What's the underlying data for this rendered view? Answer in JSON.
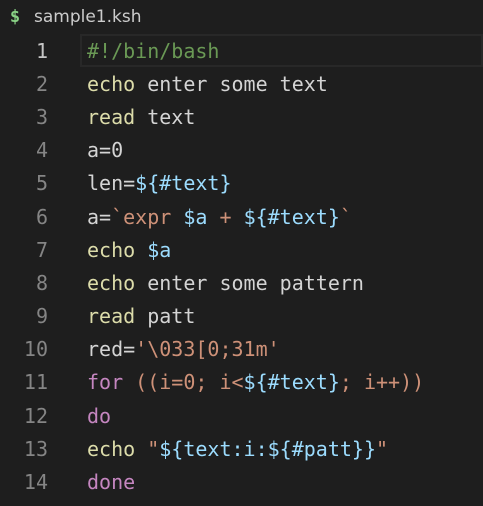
{
  "tab": {
    "icon": "$",
    "title": "sample1.ksh"
  },
  "editor": {
    "current_line": 1,
    "lines": [
      {
        "number": "1",
        "tokens": [
          {
            "text": "#!/bin/bash",
            "kind": "cmt"
          }
        ]
      },
      {
        "number": "2",
        "tokens": [
          {
            "text": "echo",
            "kind": "cmd"
          },
          {
            "text": " enter some text",
            "kind": "text"
          }
        ]
      },
      {
        "number": "3",
        "tokens": [
          {
            "text": "read",
            "kind": "cmd"
          },
          {
            "text": " text",
            "kind": "text"
          }
        ]
      },
      {
        "number": "4",
        "tokens": [
          {
            "text": "a=0",
            "kind": "text"
          }
        ]
      },
      {
        "number": "5",
        "tokens": [
          {
            "text": "len=",
            "kind": "text"
          },
          {
            "text": "${#text}",
            "kind": "var"
          }
        ]
      },
      {
        "number": "6",
        "tokens": [
          {
            "text": "a=",
            "kind": "text"
          },
          {
            "text": "`expr ",
            "kind": "str"
          },
          {
            "text": "$a",
            "kind": "var"
          },
          {
            "text": " + ",
            "kind": "str"
          },
          {
            "text": "${#text}",
            "kind": "var"
          },
          {
            "text": "`",
            "kind": "str"
          }
        ]
      },
      {
        "number": "7",
        "tokens": [
          {
            "text": "echo",
            "kind": "cmd"
          },
          {
            "text": " ",
            "kind": "text"
          },
          {
            "text": "$a",
            "kind": "var"
          }
        ]
      },
      {
        "number": "8",
        "tokens": [
          {
            "text": "echo",
            "kind": "cmd"
          },
          {
            "text": " enter some pattern",
            "kind": "text"
          }
        ]
      },
      {
        "number": "9",
        "tokens": [
          {
            "text": "read",
            "kind": "cmd"
          },
          {
            "text": " patt",
            "kind": "text"
          }
        ]
      },
      {
        "number": "10",
        "tokens": [
          {
            "text": "red=",
            "kind": "text"
          },
          {
            "text": "'\\033[0;31m'",
            "kind": "str"
          }
        ]
      },
      {
        "number": "11",
        "tokens": [
          {
            "text": "for",
            "kind": "kw"
          },
          {
            "text": " ((i=0; i<",
            "kind": "str"
          },
          {
            "text": "${#text}",
            "kind": "var"
          },
          {
            "text": "; i++))",
            "kind": "str"
          }
        ]
      },
      {
        "number": "12",
        "tokens": [
          {
            "text": "do",
            "kind": "kw"
          }
        ]
      },
      {
        "number": "13",
        "tokens": [
          {
            "text": "echo",
            "kind": "cmd"
          },
          {
            "text": " \"",
            "kind": "str"
          },
          {
            "text": "${text:i:${#patt}}",
            "kind": "var"
          },
          {
            "text": "\"",
            "kind": "str"
          }
        ]
      },
      {
        "number": "14",
        "tokens": [
          {
            "text": "done",
            "kind": "kw"
          }
        ]
      }
    ]
  },
  "colors": {
    "background": "#1e1e1e",
    "line_number": "#858585",
    "command": "#dcdcaa",
    "variable": "#9cdcfe",
    "string": "#ce9178",
    "keyword": "#c586c0",
    "comment": "#6a9955",
    "shell_icon": "#89d185"
  }
}
